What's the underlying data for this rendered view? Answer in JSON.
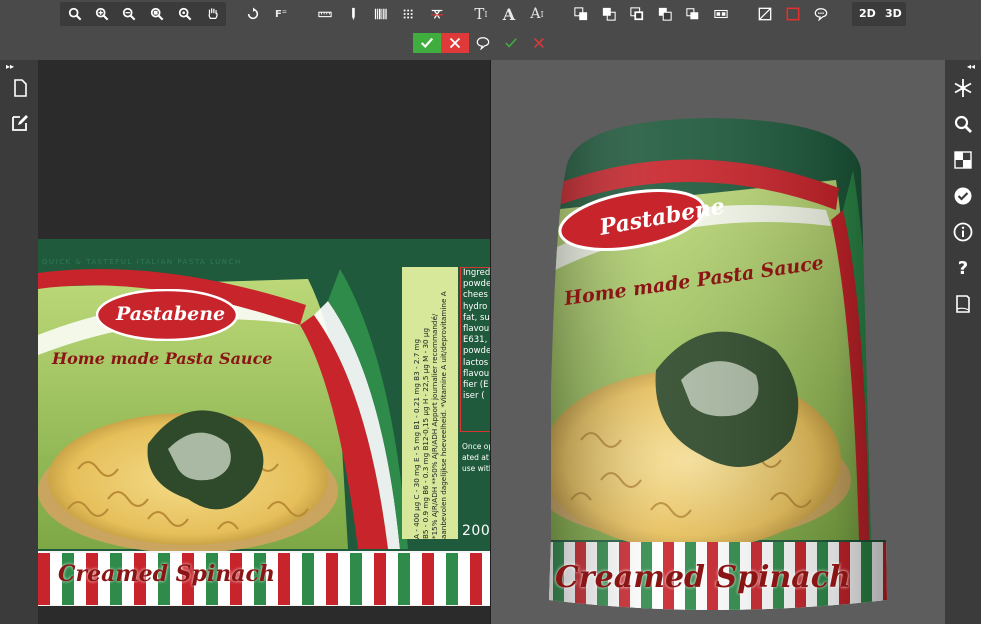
{
  "toolbar": {
    "tools": [
      "search-icon",
      "zoom-in-icon",
      "zoom-out-icon",
      "zoom-fit-icon",
      "zoom-actual-icon",
      "hand-icon",
      "rotate-icon",
      "fields-icon",
      "ruler-icon",
      "pen-icon",
      "barcode-icon",
      "dot-grid-icon",
      "strike-text-icon",
      "text-size-icon",
      "font-icon",
      "text-case-icon",
      "layer-icons",
      "fill-color-icon",
      "stroke-color-icon",
      "comment-icon"
    ],
    "view_2d_label": "2D",
    "view_3d_label": "3D",
    "colors": {
      "accept": "#3fae3f",
      "reject": "#e0393a",
      "stroke_swatch": "#e03030"
    }
  },
  "artwork": {
    "tagline": "QUICK & TASTEFUL ITALIAN PASTA LUNCH",
    "brand": "Pastabene",
    "subtitle": "Home made Pasta Sauce",
    "product": "Creamed Spinach",
    "nutrition_lines": [
      "A - 400 µg  C - 30 mg  E - 5 mg  B1 - 0.21 mg  B3 - 2.7 mg",
      "B5 - 0.9 mg  B6 - 0.3 mg  B12-0,15 µg  H - 22,5 µg  M - 30 µg",
      "*15% AJR/ADH **50% AJR/ADH Apport journalier recommandé/",
      "aanbevolen dagelijkse hoeveelheid. *Vitamine A uit/deprovitamine A"
    ],
    "ingredients": [
      "Ingred",
      "powde",
      "chees",
      "hydro",
      "fat, su",
      "flavou",
      "E631,",
      "powde",
      "lactos",
      "flavou",
      "fier (E",
      "iser ("
    ],
    "prep": [
      "Once op",
      "ated at",
      "use with"
    ],
    "weight": "200"
  },
  "preview3d": {
    "brand": "Pastabene",
    "subtitle": "Home made Pasta Sauce",
    "product": "Creamed Spinach"
  },
  "rails": {
    "left": [
      "page-icon",
      "edit-icon"
    ],
    "right": [
      "snowflake-icon",
      "search-icon",
      "checker-icon",
      "check-circle-icon",
      "info-icon",
      "help-icon",
      "document-icon"
    ]
  }
}
